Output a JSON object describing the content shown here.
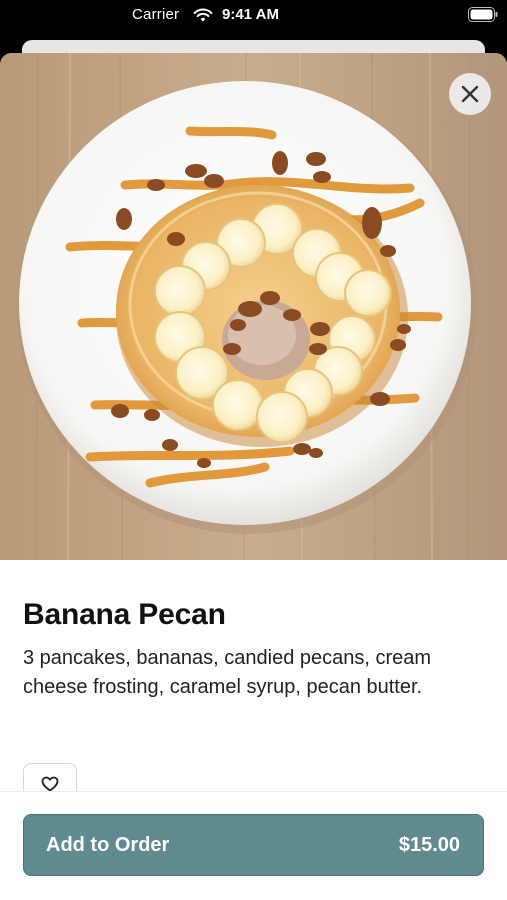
{
  "status_bar": {
    "carrier": "Carrier",
    "time": "9:41 AM"
  },
  "item": {
    "title": "Banana Pecan",
    "description": "3 pancakes, bananas, candied pecans, cream cheese frosting, caramel syrup, pecan butter.",
    "image_icon": "pancake-photo"
  },
  "actions": {
    "close_icon": "close-icon",
    "favorite_icon": "heart-icon",
    "add_label": "Add to Order",
    "price": "$15.00"
  },
  "colors": {
    "accent": "#5f8a90",
    "caramel": "#e0922c"
  }
}
